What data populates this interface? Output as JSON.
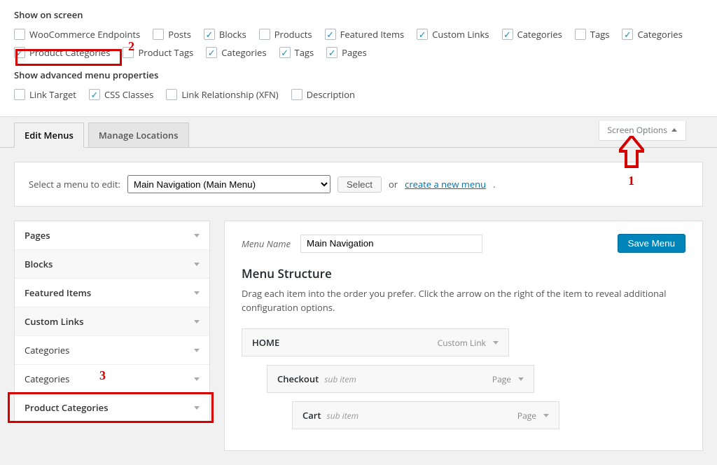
{
  "screen_options": {
    "section1_title": "Show on screen",
    "section2_title": "Show advanced menu properties",
    "row1": [
      {
        "label": "WooCommerce Endpoints",
        "checked": false
      },
      {
        "label": "Posts",
        "checked": false
      },
      {
        "label": "Blocks",
        "checked": true
      },
      {
        "label": "Products",
        "checked": false
      },
      {
        "label": "Featured Items",
        "checked": true
      },
      {
        "label": "Custom Links",
        "checked": true
      },
      {
        "label": "Categories",
        "checked": true
      },
      {
        "label": "Tags",
        "checked": false
      },
      {
        "label": "Categories",
        "checked": true
      }
    ],
    "row2": [
      {
        "label": "Product Categories",
        "checked": true
      },
      {
        "label": "Product Tags",
        "checked": false
      },
      {
        "label": "Categories",
        "checked": true
      },
      {
        "label": "Tags",
        "checked": true
      },
      {
        "label": "Pages",
        "checked": true
      }
    ],
    "row3": [
      {
        "label": "Link Target",
        "checked": false
      },
      {
        "label": "CSS Classes",
        "checked": true
      },
      {
        "label": "Link Relationship (XFN)",
        "checked": false
      },
      {
        "label": "Description",
        "checked": false
      }
    ]
  },
  "tabs": {
    "edit_menus": "Edit Menus",
    "manage_locations": "Manage Locations"
  },
  "toggle_label": "Screen Options",
  "select_row": {
    "prompt": "Select a menu to edit:",
    "selected": "Main Navigation (Main Menu)",
    "select_btn": "Select",
    "or": "or",
    "create_link": "create a new menu",
    "period": "."
  },
  "accordion": [
    {
      "label": "Pages",
      "bold": true,
      "gray": false
    },
    {
      "label": "Blocks",
      "bold": true,
      "gray": true
    },
    {
      "label": "Featured Items",
      "bold": true,
      "gray": false
    },
    {
      "label": "Custom Links",
      "bold": true,
      "gray": true
    },
    {
      "label": "Categories",
      "bold": false,
      "gray": false
    },
    {
      "label": "Categories",
      "bold": false,
      "gray": false
    },
    {
      "label": "Product Categories",
      "bold": true,
      "gray": false
    }
  ],
  "menu_form": {
    "name_label": "Menu Name",
    "name_value": "Main Navigation",
    "save_btn": "Save Menu",
    "structure_title": "Menu Structure",
    "structure_desc": "Drag each item into the order you prefer. Click the arrow on the right of the item to reveal additional configuration options."
  },
  "menu_items": [
    {
      "title": "HOME",
      "sub": "",
      "type": "Custom Link",
      "indent": 0
    },
    {
      "title": "Checkout",
      "sub": "sub item",
      "type": "Page",
      "indent": 1
    },
    {
      "title": "Cart",
      "sub": "sub item",
      "type": "Page",
      "indent": 2
    }
  ],
  "annotations": {
    "a1": "1",
    "a2": "2",
    "a3": "3"
  }
}
